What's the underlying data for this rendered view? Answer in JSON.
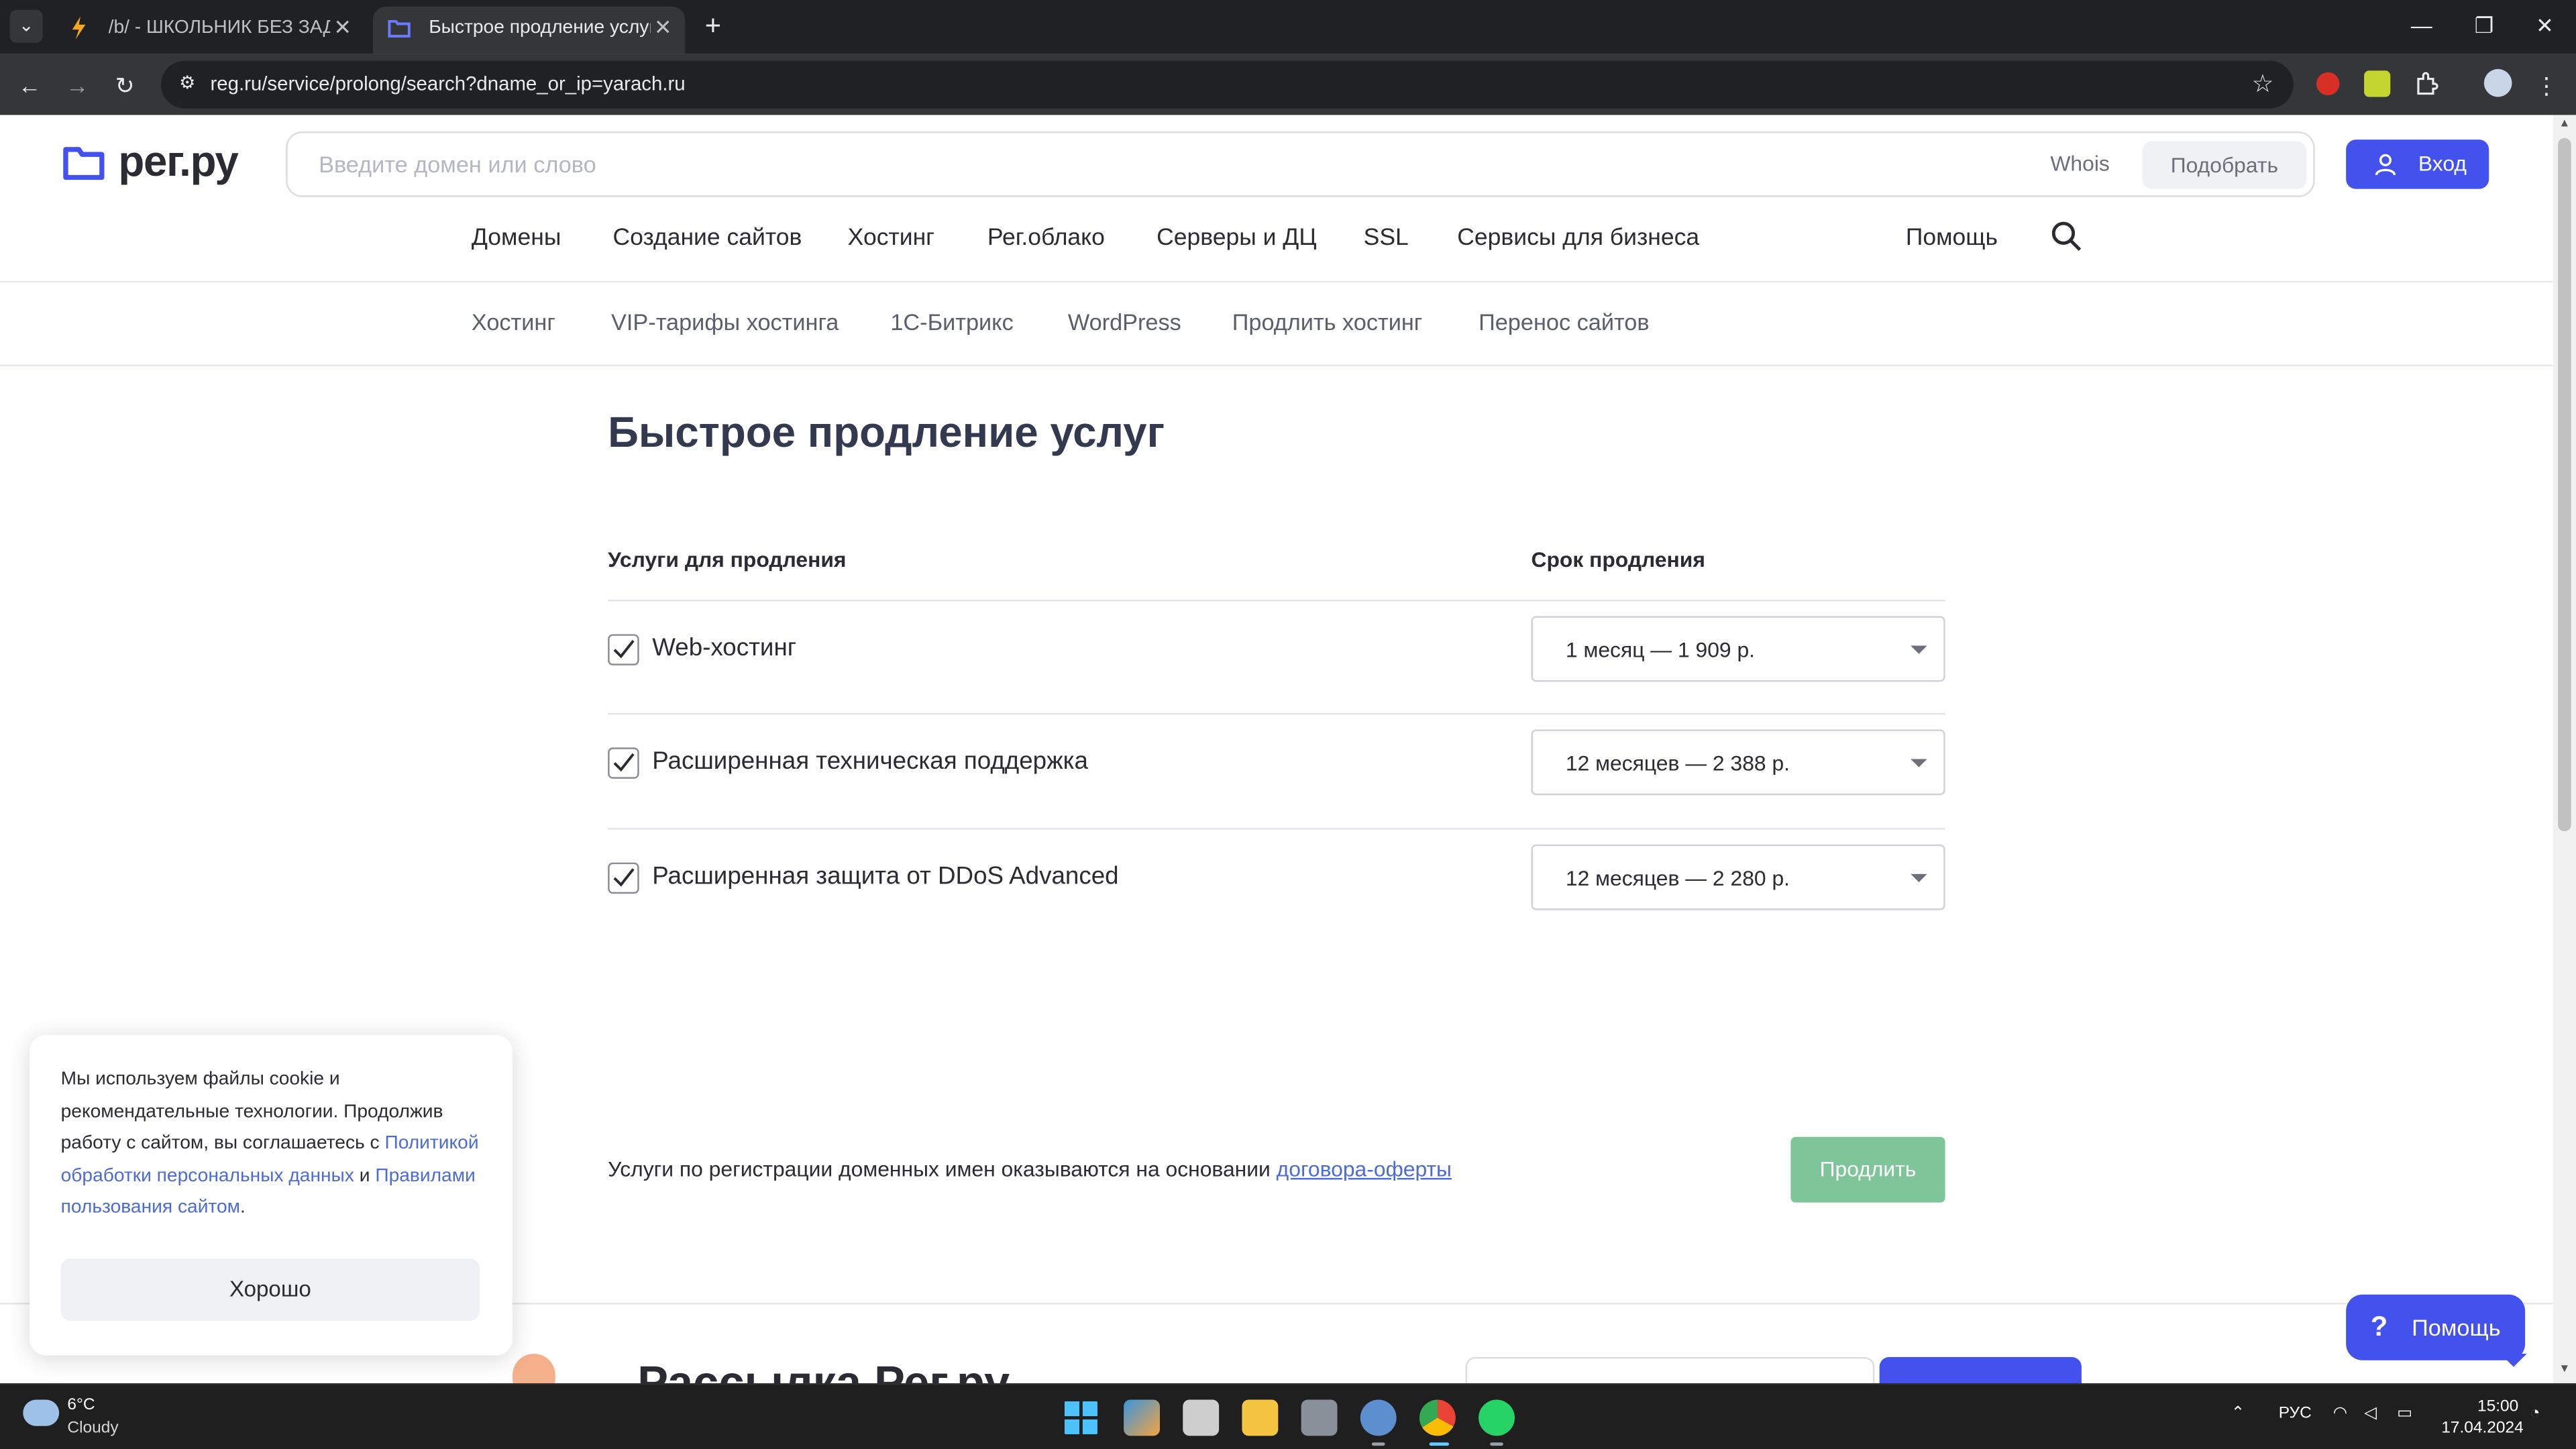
{
  "browser": {
    "tabs": [
      {
        "title": "/b/ - ШКОЛЬНИК БЕЗ ЗАДНЕ",
        "active": false
      },
      {
        "title": "Быстрое продление услуг | Рег.ру",
        "active": true
      }
    ],
    "url": "reg.ru/service/prolong/search?dname_or_ip=yarach.ru",
    "tab_menu_glyph": "⌄",
    "new_tab_glyph": "+",
    "close_glyph": "✕",
    "window_buttons": {
      "minimize": "—",
      "restore": "❐",
      "close": "✕"
    },
    "nav": {
      "back": "←",
      "forward": "→",
      "reload": "↻",
      "site_info": "⚙",
      "star": "☆",
      "menu": "⋮"
    }
  },
  "header": {
    "logo_text": "рег.ру",
    "search_placeholder": "Введите домен или слово",
    "whois": "Whois",
    "pick_button": "Подобрать",
    "login_button": "Вход"
  },
  "main_nav": [
    "Домены",
    "Создание сайтов",
    "Хостинг",
    "Рег.облако",
    "Серверы и ДЦ",
    "SSL",
    "Сервисы для бизнеса"
  ],
  "help_link": "Помощь",
  "sub_nav": [
    "Хостинг",
    "VIP-тарифы хостинга",
    "1С-Битрикс",
    "WordPress",
    "Продлить хостинг",
    "Перенос сайтов"
  ],
  "content": {
    "title": "Быстрое продление услуг",
    "col_services": "Услуги для продления",
    "col_period": "Срок продления",
    "services": [
      {
        "label": "Web-хостинг",
        "checked": true,
        "period": "1 месяц — 1 909 р."
      },
      {
        "label": "Расширенная техническая поддержка",
        "checked": true,
        "period": "12 месяцев — 2 388 р."
      },
      {
        "label": "Расширенная защита от DDoS Advanced",
        "checked": true,
        "period": "12 месяцев — 2 280 р."
      }
    ],
    "offer_text": "Услуги по регистрации доменных имен оказываются на основании ",
    "offer_link": "договора-оферты",
    "renew_button": "Продлить",
    "newsletter_title": "Рассылка Рег.ру"
  },
  "cookie": {
    "text_1": "Мы используем файлы cookie и рекомендательные технологии. Продолжив работу с сайтом, вы соглашаетесь с ",
    "link_1": "Политикой обработки персональных данных",
    "text_2": " и ",
    "link_2": "Правилами пользования сайтом",
    "text_3": ".",
    "button": "Хорошо"
  },
  "help_widget": {
    "icon": "?",
    "label": "Помощь"
  },
  "taskbar": {
    "temp": "6°C",
    "condition": "Cloudy",
    "lang": "РУС",
    "time": "15:00",
    "date": "17.04.2024"
  },
  "colors": {
    "brand_blue": "#4352ed",
    "renew_green": "#7fc59a",
    "link_blue": "#4b6cd6"
  }
}
